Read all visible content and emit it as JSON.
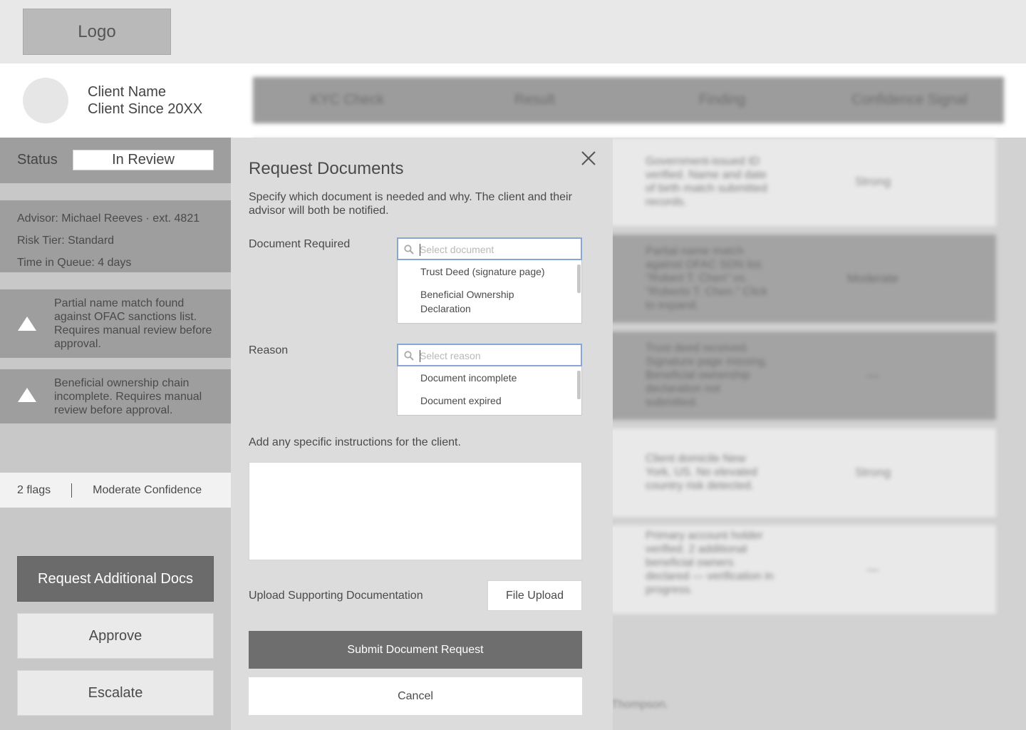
{
  "header": {
    "logo_text": "Logo"
  },
  "client": {
    "name": "Client Name",
    "since": "Client Since 20XX"
  },
  "status": {
    "label": "Status",
    "value": "In Review"
  },
  "meta": {
    "advisor": "Advisor: Michael Reeves · ext. 4821",
    "risk_tier": "Risk Tier: Standard",
    "time_in_queue": "Time in Queue: 4 days"
  },
  "flags": [
    {
      "text": "Partial name match found against OFAC sanctions list. Requires manual review before approval."
    },
    {
      "text": "Beneficial ownership chain incomplete. Requires manual review before approval."
    }
  ],
  "summary": {
    "flags_count": "2 flags",
    "confidence": "Moderate Confidence"
  },
  "actions": {
    "request_docs": "Request Additional Docs",
    "approve": "Approve",
    "escalate": "Escalate"
  },
  "table": {
    "columns": [
      "KYC Check",
      "Result",
      "Finding",
      "Confidence Signal"
    ],
    "rows": [
      {
        "finding": "Government-issued ID verified. Name and date of birth match submitted records.",
        "signal": "Strong",
        "shade": "light"
      },
      {
        "finding": "Partial name match against OFAC SDN list. \"Robert T. Chen\" vs. \"Roberto T. Chen.\" Click to expand.",
        "signal": "Moderate",
        "shade": "dark"
      },
      {
        "finding": "Trust deed received. Signature page missing. Beneficial ownership declaration not submitted.",
        "signal": "—",
        "shade": "dark"
      },
      {
        "finding": "Client domicile New York, US. No elevated country risk detected.",
        "signal": "Strong",
        "shade": "light"
      },
      {
        "finding": "Primary account holder verified. 2 additional beneficial owners declared — verification in progress.",
        "signal": "—",
        "shade": "light"
      }
    ],
    "footer_note": "Thompson."
  },
  "modal": {
    "title": "Request Documents",
    "subtitle": "Specify which document is needed and why. The client and their advisor will both be notified.",
    "document_label": "Document Required",
    "document_placeholder": "Select document",
    "document_options": [
      "Trust Deed (signature page)",
      "Beneficial Ownership Declaration"
    ],
    "reason_label": "Reason",
    "reason_placeholder": "Select reason",
    "reason_options": [
      "Document incomplete",
      "Document expired"
    ],
    "instructions_label": "Add any specific instructions for the client.",
    "upload_label": "Upload Supporting Documentation",
    "upload_button": "File Upload",
    "submit_button": "Submit Document Request",
    "cancel_button": "Cancel"
  },
  "icons": {
    "close": "close-icon",
    "search": "search-icon",
    "warning": "warning-icon"
  }
}
